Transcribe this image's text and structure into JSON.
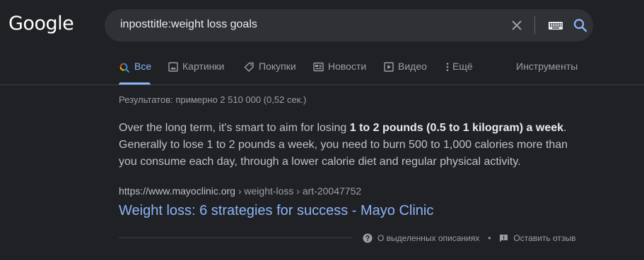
{
  "logo": {
    "text": "Google"
  },
  "search": {
    "query": "inposttitle:weight loss goals",
    "clear_icon": "close-icon",
    "keyboard_icon": "keyboard-icon",
    "search_icon": "search-icon"
  },
  "tabs": [
    {
      "label": "Все",
      "icon": "search-multicolor-icon",
      "active": true
    },
    {
      "label": "Картинки",
      "icon": "image-icon"
    },
    {
      "label": "Покупки",
      "icon": "tag-icon"
    },
    {
      "label": "Новости",
      "icon": "newspaper-icon"
    },
    {
      "label": "Видео",
      "icon": "play-icon"
    },
    {
      "label": "Ещё",
      "icon": "more-vert-icon"
    }
  ],
  "tools_label": "Инструменты",
  "result_stats": "Результатов: примерно 2 510 000 (0,52 сек.)",
  "featured_snippet": {
    "text_before": "Over the long term, it's smart to aim for losing ",
    "text_bold": "1 to 2 pounds (0.5 to 1 kilogram) a week",
    "text_after": ". Generally to lose 1 to 2 pounds a week, you need to burn 500 to 1,000 calories more than you consume each day, through a lower calorie diet and regular physical activity."
  },
  "result": {
    "cite_domain": "https://www.mayoclinic.org",
    "cite_path": " › weight-loss › art-20047752",
    "title": "Weight loss: 6 strategies for success - Mayo Clinic"
  },
  "footer": {
    "about_label": "О выделенных описаниях",
    "feedback_label": "Оставить отзыв",
    "separator": "•"
  },
  "colors": {
    "background": "#202124",
    "search_bg": "#303134",
    "link": "#8ab4f8",
    "text": "#bdc1c6",
    "muted": "#9aa0a6"
  }
}
